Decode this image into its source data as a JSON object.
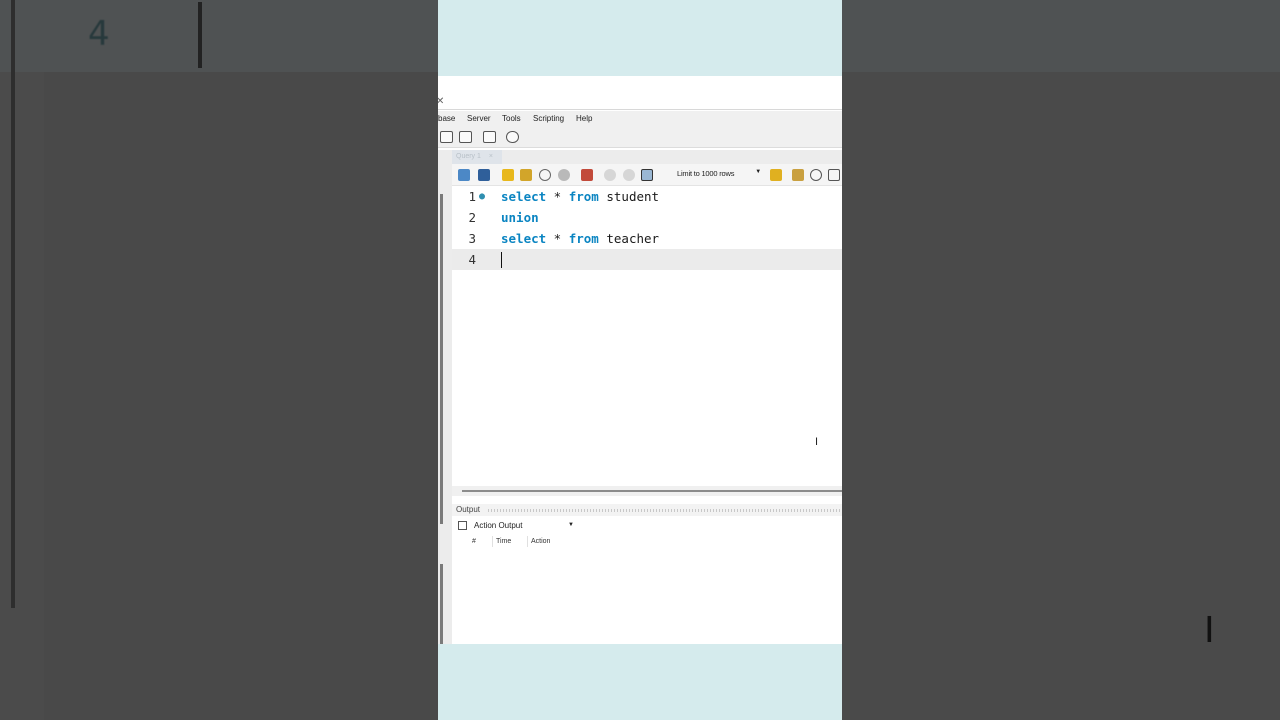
{
  "menu": {
    "items": [
      "base",
      "Server",
      "Tools",
      "Scripting",
      "Help"
    ]
  },
  "tabs": {
    "query_tab": "Query 1"
  },
  "editor_toolbar": {
    "limit_label": "Limit to 1000 rows"
  },
  "editor": {
    "lines": [
      {
        "num": "1",
        "kw1": "select",
        "mid": " * ",
        "kw2": "from",
        "rest": " student"
      },
      {
        "num": "2",
        "kw1": "union",
        "mid": "",
        "kw2": "",
        "rest": ""
      },
      {
        "num": "3",
        "kw1": "select",
        "mid": " * ",
        "kw2": "from",
        "rest": " teacher"
      },
      {
        "num": "4",
        "kw1": "",
        "mid": "",
        "kw2": "",
        "rest": ""
      }
    ],
    "ibeam": "I"
  },
  "output": {
    "header": "Output",
    "selector": "Action Output",
    "columns": [
      "#",
      "Time",
      "Action"
    ]
  },
  "background": {
    "line_number": "4",
    "ibeam": "I"
  },
  "colors": {
    "keyword": "#0b85c2",
    "frame_bg": "#d5ebed",
    "page_bg": "#4a4a4a"
  }
}
